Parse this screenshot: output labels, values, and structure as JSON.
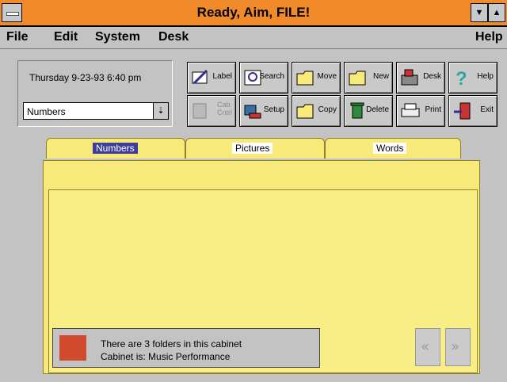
{
  "window": {
    "title": "Ready, Aim, FILE!",
    "min_glyph": "▼",
    "max_glyph": "▲"
  },
  "menu": {
    "file": "File",
    "edit": "Edit",
    "system": "System",
    "desk": "Desk",
    "help": "Help"
  },
  "info": {
    "datetime": "Thursday 9-23-93 6:40 pm",
    "cabinet_select": "Numbers",
    "select_arrow": "⇣"
  },
  "toolbar": [
    {
      "label": "Label",
      "icon": "label-icon"
    },
    {
      "label": "Search",
      "icon": "search-icon"
    },
    {
      "label": "Move",
      "icon": "move-icon"
    },
    {
      "label": "New",
      "icon": "new-folder-icon"
    },
    {
      "label": "Desk",
      "icon": "desk-icon"
    },
    {
      "label": "Help",
      "icon": "help-icon"
    },
    {
      "label": "Cab\nCntrl",
      "icon": "cabinet-control-icon"
    },
    {
      "label": "Setup",
      "icon": "setup-icon"
    },
    {
      "label": "Copy",
      "icon": "copy-icon"
    },
    {
      "label": "Delete",
      "icon": "delete-icon"
    },
    {
      "label": "Print",
      "icon": "print-icon"
    },
    {
      "label": "Exit",
      "icon": "exit-icon"
    }
  ],
  "tabs": [
    {
      "label": "Numbers",
      "active": true
    },
    {
      "label": "Pictures",
      "active": false
    },
    {
      "label": "Words",
      "active": false
    }
  ],
  "status": {
    "line1": "There are 3 folders in this cabinet",
    "line2": "Cabinet is:  Music Performance"
  },
  "colors": {
    "titlebar": "#f08a2a",
    "folder": "#f7ea7a",
    "status_icon": "#d14a2e",
    "active_tab": "#3e3e9a"
  }
}
